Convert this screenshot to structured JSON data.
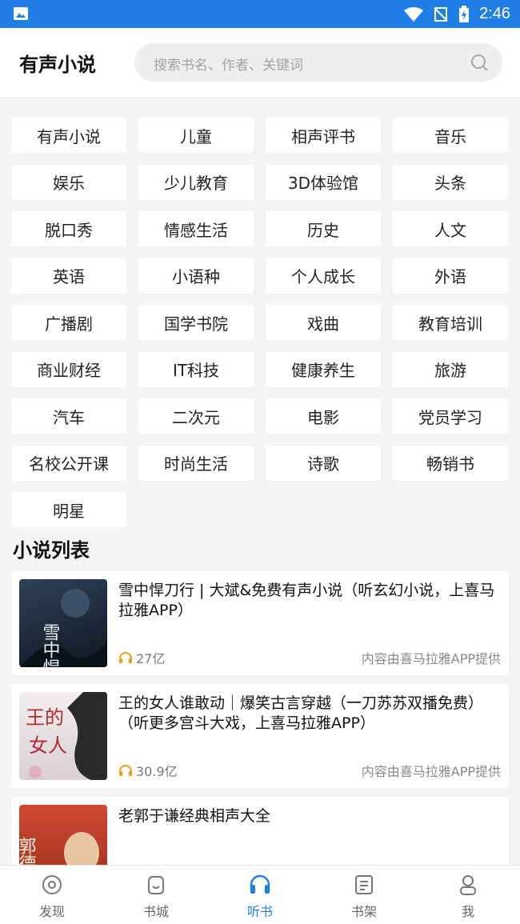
{
  "status_bar": {
    "time": "2:46"
  },
  "header": {
    "title": "有声小说",
    "search_placeholder": "搜索书名、作者、关键词"
  },
  "categories": [
    "有声小说",
    "儿童",
    "相声评书",
    "音乐",
    "娱乐",
    "少儿教育",
    "3D体验馆",
    "头条",
    "脱口秀",
    "情感生活",
    "历史",
    "人文",
    "英语",
    "小语种",
    "个人成长",
    "外语",
    "广播剧",
    "国学书院",
    "戏曲",
    "教育培训",
    "商业财经",
    "IT科技",
    "健康养生",
    "旅游",
    "汽车",
    "二次元",
    "电影",
    "党员学习",
    "名校公开课",
    "时尚生活",
    "诗歌",
    "畅销书",
    "明星"
  ],
  "section_title": "小说列表",
  "books": [
    {
      "title": "雪中悍刀行 | 大斌&免费有声小说（听玄幻小说，上喜马拉雅APP）",
      "plays": "27亿",
      "source": "内容由喜马拉雅APP提供",
      "cover_color": "#1a2a3a",
      "cover_text": "雪中悍刀行"
    },
    {
      "title": "王的女人谁敢动｜爆笑古言穿越（一刀苏苏双播免费）（听更多宫斗大戏，上喜马拉雅APP）",
      "plays": "30.9亿",
      "source": "内容由喜马拉雅APP提供",
      "cover_color": "#e9e4e6",
      "cover_text": "王的女人"
    },
    {
      "title": "老郭于谦经典相声大全",
      "plays": "",
      "source": "",
      "cover_color": "#c0412b",
      "cover_text": "郭德纲"
    }
  ],
  "bottom_nav": [
    {
      "label": "发现",
      "icon": "compass-icon",
      "active": false
    },
    {
      "label": "书城",
      "icon": "store-icon",
      "active": false
    },
    {
      "label": "听书",
      "icon": "headphones-icon",
      "active": true
    },
    {
      "label": "书架",
      "icon": "bookshelf-icon",
      "active": false
    },
    {
      "label": "我",
      "icon": "profile-icon",
      "active": false
    }
  ],
  "colors": {
    "accent": "#1f7fe6",
    "plays_icon": "#f39c12"
  }
}
